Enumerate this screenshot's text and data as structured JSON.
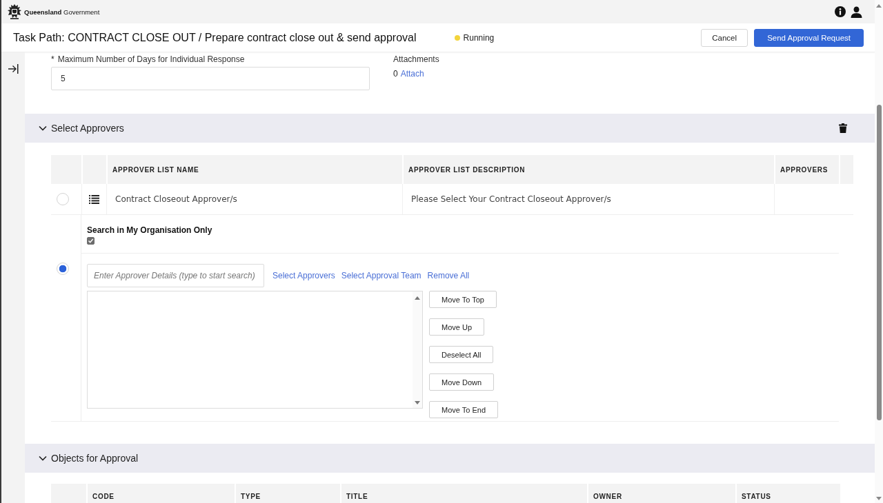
{
  "header": {
    "brand": "**Queensland** Government"
  },
  "task": {
    "title": "Task Path: CONTRACT CLOSE OUT / Prepare contract close out & send approval",
    "status": {
      "color": "#f3d43c",
      "label": "Running"
    },
    "buttons": [
      {
        "label": "Cancel",
        "kind": "secondary"
      },
      {
        "label": "Send Approval Request",
        "kind": "primary"
      }
    ]
  },
  "form": {
    "max_days": {
      "required_mark": "*",
      "label": "Maximum Number of Days for Individual Response",
      "value": "5"
    },
    "attachments": {
      "label": "Attachments",
      "count": "0",
      "link": "Attach"
    }
  },
  "select_approvers": {
    "title": "Select Approvers",
    "expanded": true,
    "table": {
      "columns": [
        "APPROVER LIST NAME",
        "APPROVER LIST DESCRIPTION",
        "APPROVERS"
      ],
      "rows": [
        {
          "selected": false,
          "name": "Contract Closeout Approver/s",
          "description": "Please Select Your Contract Closeout Approver/s"
        }
      ]
    },
    "detail": {
      "search_scope": {
        "label": "Search in My Organisation Only",
        "checked": true
      },
      "selected": true,
      "search": {
        "placeholder": "Enter Approver Details (type to start search)"
      },
      "links": [
        "Select Approvers",
        "Select Approval Team",
        "Remove All"
      ],
      "order_buttons": [
        "Move To Top",
        "Move Up",
        "Deselect All",
        "Move Down",
        "Move To End"
      ]
    }
  },
  "objects_for_approval": {
    "title": "Objects for Approval",
    "expanded": true,
    "table": {
      "columns": [
        "CODE",
        "TYPE",
        "TITLE",
        "OWNER",
        "STATUS"
      ]
    }
  }
}
